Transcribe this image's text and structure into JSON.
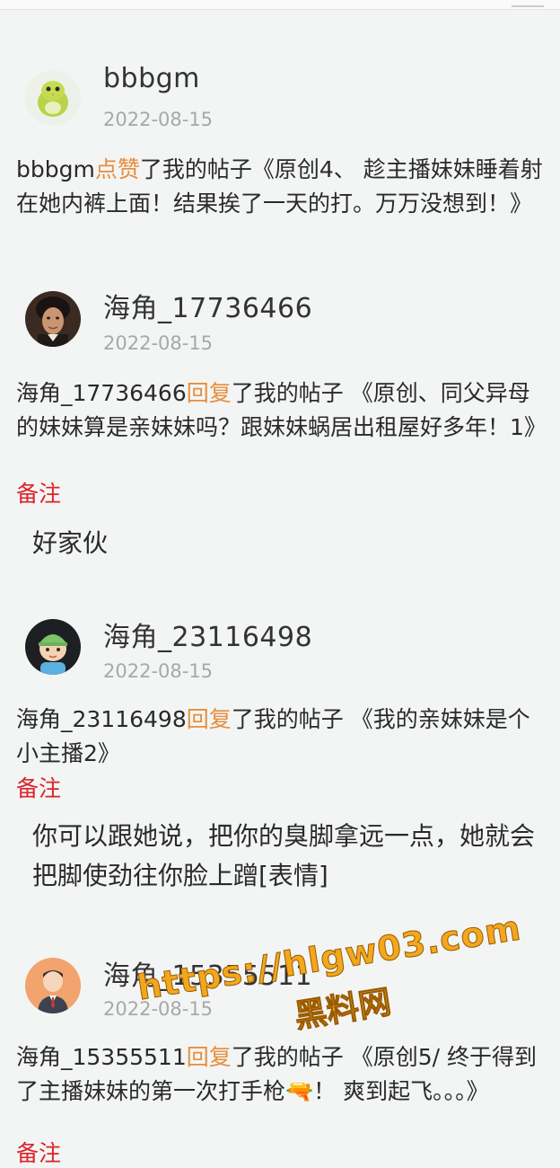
{
  "entries": [
    {
      "username": "bbbgm",
      "date": "2022-08-15",
      "actor": "bbbgm",
      "action": "点赞",
      "message_rest": "了我的帖子《原创4、 趁主播妹妹睡着射在她内裤上面！结果挨了一天的打。万万没想到！》",
      "avatar": "green-bird-avatar"
    },
    {
      "username": "海角_17736466",
      "date": "2022-08-15",
      "actor": "海角_17736466",
      "action": "回复",
      "message_rest": "了我的帖子 《原创、同父异母的妹妹算是亲妹妹吗？跟妹妹蜗居出租屋好多年！1》",
      "remark_label": "备注",
      "remark_text": "好家伙",
      "avatar": "portrait-photo-avatar"
    },
    {
      "username": "海角_23116498",
      "date": "2022-08-15",
      "actor": "海角_23116498",
      "action": "回复",
      "message_rest": "了我的帖子 《我的亲妹妹是个小主播2》",
      "remark_label": "备注",
      "remark_text": "你可以跟她说，把你的臭脚拿远一点，她就会把脚使劲往你脸上蹭[表情]",
      "avatar": "boy-green-hat-avatar"
    },
    {
      "username": "海角_15355511",
      "date": "2022-08-15",
      "actor": "海角_15355511",
      "action": "回复",
      "message_rest": "了我的帖子 《原创5/ 终于得到了主播妹妹的第一次打手枪🔫！ 爽到起飞。。。》",
      "remark_label": "备注",
      "avatar": "man-in-suit-avatar"
    }
  ],
  "watermark": {
    "url": "https://hlgw03.com",
    "name": "黑料网"
  },
  "colors": {
    "action": "#e88d3c",
    "remark": "#d9242a",
    "date": "#a7a9a8",
    "background": "#f3f5f4"
  }
}
